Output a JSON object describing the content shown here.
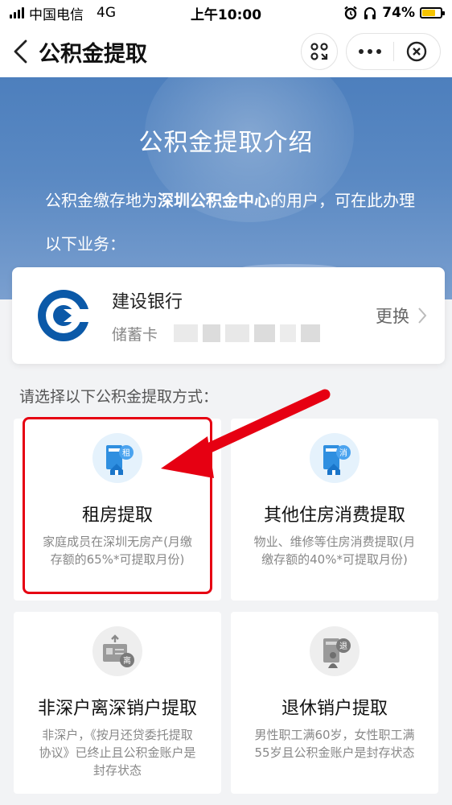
{
  "status_bar": {
    "carrier": "中国电信",
    "network": "4G",
    "time": "上午10:00",
    "battery": "74%",
    "battery_level": 0.74
  },
  "nav": {
    "title": "公积金提取"
  },
  "banner": {
    "title": "公积金提取介绍",
    "desc_prefix": "公积金缴存地为",
    "desc_highlight": "深圳公积金中心",
    "desc_suffix": "的用户，可在此办理以下业务："
  },
  "bank_card": {
    "bank_name": "建设银行",
    "card_type": "储蓄卡",
    "change_label": "更换"
  },
  "section_label": "请选择以下公积金提取方式：",
  "options": [
    {
      "title": "租房提取",
      "desc": "家庭成员在深圳无房产(月缴存额的65%*可提取月份)",
      "badge": "租",
      "icon": "house-rent-icon"
    },
    {
      "title": "其他住房消费提取",
      "desc": "物业、维修等住房消费提取(月缴存额的40%*可提取月份)",
      "badge": "消",
      "icon": "house-consume-icon"
    },
    {
      "title": "非深户离深销户提取",
      "desc": "非深户，《按月还贷委托提取协议》已终止且公积金账户是封存状态",
      "badge": "离",
      "icon": "leave-card-icon"
    },
    {
      "title": "退休销户提取",
      "desc": "男性职工满60岁，女性职工满55岁且公积金账户是封存状态",
      "badge": "退",
      "icon": "retire-icon"
    }
  ],
  "colors": {
    "highlight": "#e60012",
    "accent_blue": "#2f8fe0",
    "icon_bg": "#e5f2fc"
  }
}
